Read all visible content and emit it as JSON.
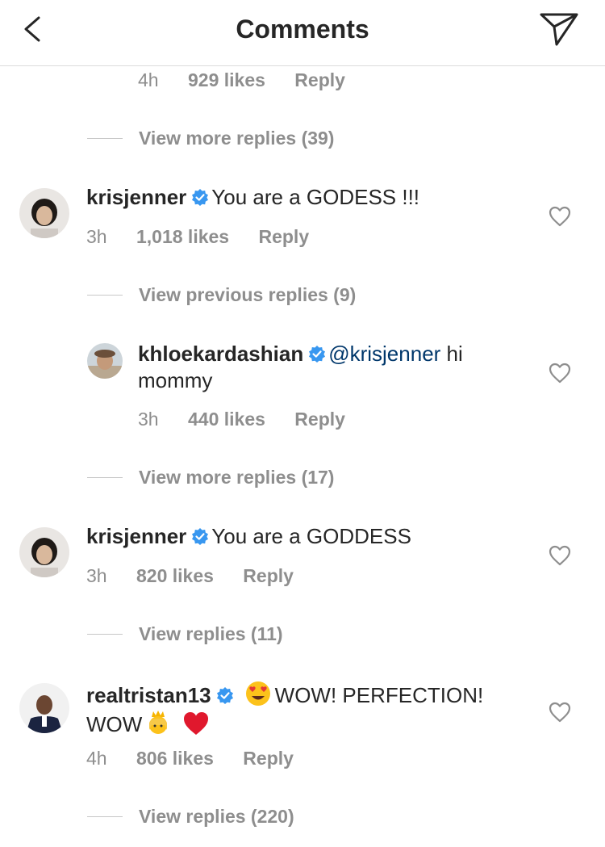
{
  "header": {
    "title": "Comments",
    "back_icon": "chevron-left-icon",
    "send_icon": "paper-plane-icon"
  },
  "top_reply_meta": {
    "time": "4h",
    "likes": "929 likes",
    "reply": "Reply"
  },
  "view_more_1": "View more replies (39)",
  "comments": [
    {
      "username": "krisjenner",
      "text": "You are a GODESS !!!",
      "time": "3h",
      "likes": "1,018 likes",
      "reply": "Reply",
      "view_replies": "View previous replies (9)",
      "nested": {
        "username": "khloekardashian",
        "mention": "@krisjenner",
        "text_after_mention": " hi",
        "text_line2": "mommy",
        "time": "3h",
        "likes": "440 likes",
        "reply": "Reply",
        "view_more": "View more replies (17)"
      }
    },
    {
      "username": "krisjenner",
      "text": "You are a GODDESS",
      "time": "3h",
      "likes": "820 likes",
      "reply": "Reply",
      "view_replies": "View replies (11)"
    },
    {
      "username": "realtristan13",
      "text": "WOW! PERFECTION!",
      "text_line2": "WOW",
      "time": "4h",
      "likes": "806 likes",
      "reply": "Reply",
      "view_replies": "View replies (220)"
    }
  ],
  "colors": {
    "text": "#262626",
    "secondary": "#8e8e8e",
    "verified": "#3897f0",
    "mention": "#00376b",
    "divider": "#dbdbdb"
  }
}
